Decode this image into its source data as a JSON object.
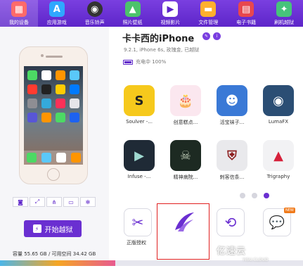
{
  "nav": [
    {
      "label": "我的设备",
      "icon": "device-icon",
      "color": "#ff6a6a"
    },
    {
      "label": "应用游戏",
      "icon": "app-store-icon",
      "color": "#2fa7ff"
    },
    {
      "label": "音乐铃声",
      "icon": "music-icon",
      "color": "#333333"
    },
    {
      "label": "照片壁纸",
      "icon": "photo-icon",
      "color": "#4cc36b"
    },
    {
      "label": "视频影片",
      "icon": "video-icon",
      "color": "#ffffff"
    },
    {
      "label": "文件管理",
      "icon": "folder-icon",
      "color": "#ffb02e"
    },
    {
      "label": "电子书籍",
      "icon": "book-icon",
      "color": "#e8474e"
    },
    {
      "label": "刷机越狱",
      "icon": "jailbreak-icon",
      "color": "#46c37b"
    }
  ],
  "device": {
    "name": "卡卡西的iPhone",
    "info": "9.2.1, iPhone 6s, 玫瑰金, 已越狱",
    "battery_text": "充电中 100%"
  },
  "left": {
    "jailbreak_button": "开始越狱",
    "storage": "容量  55.65 GB / 可用空间  34.42 GB"
  },
  "apps": [
    {
      "label": "Soulver -...",
      "color": "#f6c91c",
      "glyph": "S"
    },
    {
      "label": "创意糕点...",
      "color": "#fbe7ef",
      "glyph": "🎂"
    },
    {
      "label": "活宝袜子...",
      "color": "#3a79d6",
      "glyph": "👾"
    },
    {
      "label": "LumaFX",
      "color": "#2b4e74",
      "glyph": "◉"
    },
    {
      "label": "Infuse -...",
      "color": "#1f2a36",
      "glyph": "▶"
    },
    {
      "label": "精神病院...",
      "color": "#1d2a22",
      "glyph": "☠"
    },
    {
      "label": "刺客信条...",
      "color": "#e9e9ec",
      "glyph": "⛨"
    },
    {
      "label": "Trigraphy",
      "color": "#f2f2f4",
      "glyph": "▲"
    }
  ],
  "tiles": [
    {
      "label": "正版授权",
      "icon": "wrench-icon"
    },
    {
      "label": "",
      "icon": "wing-logo-icon"
    },
    {
      "label": "",
      "icon": "history-icon"
    },
    {
      "label": "",
      "icon": "chat-icon"
    }
  ],
  "new_badge": "NEW",
  "watermark": "亿速云",
  "watermark_sub": "YISU.CLOUD",
  "storage_bar": {
    "used_fraction": 0.38
  },
  "accent": "#6a2fd1"
}
